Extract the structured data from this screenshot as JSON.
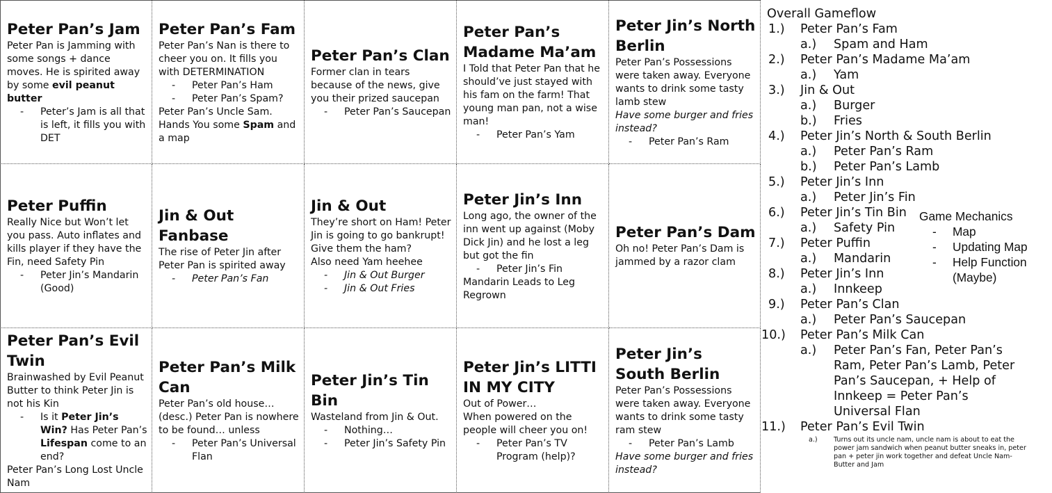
{
  "cells": [
    {
      "title": "Peter Pan’s Jam",
      "lines": [
        {
          "t": "Peter Pan is Jamming with some songs + dance moves. He is spirited away by some "
        },
        {
          "t": "evil peanut butter",
          "b": true
        },
        {
          "t": "Peter’s Jam is all that is left, it fills you with DET",
          "sub": true
        }
      ]
    },
    {
      "title": "Peter Pan’s Fam",
      "lines": [
        {
          "t": "Peter Pan’s Nan is there to cheer you on. It fills you with DETERMINATION"
        },
        {
          "t": "Peter Pan’s Ham",
          "sub": true
        },
        {
          "t": "Peter Pan’s Spam?",
          "sub": true
        },
        {
          "t": "Peter Pan’s Uncle Sam. Hands You some "
        },
        {
          "t": "Spam",
          "b": true
        },
        {
          "t": " and a map"
        }
      ]
    },
    {
      "title": "Peter Pan’s Clan",
      "lines": [
        {
          "t": "Former clan in tears because of the news, give you their prized saucepan"
        },
        {
          "t": "Peter Pan’s Saucepan",
          "sub": true
        }
      ]
    },
    {
      "title": "Peter Pan’s Madame Ma’am",
      "lines": [
        {
          "t": "I Told that Peter Pan that he should’ve just stayed with his fam on the farm! That young man pan, not a wise man!"
        },
        {
          "t": "Peter Pan’s Yam",
          "sub": true
        }
      ]
    },
    {
      "title": "Peter Jin’s North Berlin",
      "lines": [
        {
          "t": "Peter Pan’s Possessions were taken away. Everyone wants to drink some tasty lamb stew"
        },
        {
          "t": "Have some burger and fries instead?",
          "i": true
        },
        {
          "t": "Peter Pan’s Ram",
          "sub": true
        }
      ]
    },
    {
      "title": "Peter Puffin",
      "small": true,
      "lines": [
        {
          "t": "Really Nice but Won’t let you pass. Auto inflates and kills player if they have the Fin, need Safety Pin"
        },
        {
          "t": "Peter Jin’s Mandarin (Good)",
          "sub": true
        }
      ]
    },
    {
      "title": "Jin & Out Fanbase",
      "lines": [
        {
          "t": "The rise of Peter Jin after Peter Pan is spirited away"
        },
        {
          "t": "Peter Pan’s Fan",
          "sub": true,
          "i": true
        }
      ]
    },
    {
      "title": "Jin & Out",
      "lines": [
        {
          "t": "They’re short on Ham! Peter Jin is going to go bankrupt! Give them the ham?"
        },
        {
          "t": "Also need Yam heehee"
        },
        {
          "t": "Jin & Out Burger",
          "sub": true,
          "i": true
        },
        {
          "t": "Jin & Out Fries",
          "sub": true,
          "i": true
        }
      ]
    },
    {
      "title": "Peter Jin’s Inn",
      "lines": [
        {
          "t": "Long ago, the owner of the inn went up against (Moby Dick Jin) and he lost a leg but got the fin"
        },
        {
          "t": "Peter Jin’s Fin",
          "sub": true
        },
        {
          "t": "Mandarin Leads to Leg Regrown"
        }
      ]
    },
    {
      "title": "Peter Pan’s Dam",
      "lines": [
        {
          "t": "Oh no! Peter Pan’s Dam is jammed by a razor clam"
        }
      ]
    },
    {
      "title": "Peter Pan’s Evil Twin",
      "lines": [
        {
          "t": "Brainwashed by Evil Peanut Butter to think Peter Jin is not his Kin"
        },
        {
          "t": "Is it ",
          "sub": true,
          "rich": [
            [
              "Is it ",
              false
            ],
            [
              "Peter Jin’s Win?",
              true
            ],
            [
              " Has Peter Pan’s ",
              false
            ],
            [
              "Lifespan",
              true
            ],
            [
              " come to an end?",
              false
            ]
          ]
        },
        {
          "t": "Peter Pan’s Long Lost Uncle Nam"
        }
      ]
    },
    {
      "title": "Peter Pan’s Milk Can",
      "lines": [
        {
          "t": "Peter Pan’s old house… (desc.) Peter Pan is nowhere to be found… unless"
        },
        {
          "t": "Peter Pan’s Universal Flan",
          "sub": true
        }
      ]
    },
    {
      "title": "Peter Jin’s Tin Bin",
      "lines": [
        {
          "t": "Wasteland from Jin & Out."
        },
        {
          "t": "Nothing…",
          "sub": true
        },
        {
          "t": "Peter Jin’s Safety Pin",
          "sub": true
        }
      ]
    },
    {
      "title": "Peter Jin’s LITTI IN MY CITY",
      "lines": [
        {
          "t": "Out of Power…"
        },
        {
          "t": "When powered on the people will cheer you on!"
        },
        {
          "t": "Peter Pan’s TV Program (help)?",
          "sub": true
        }
      ]
    },
    {
      "title": "Peter Jin’s South Berlin",
      "lines": [
        {
          "t": "Peter Pan’s Possessions were taken away. Everyone wants to drink some tasty ram stew"
        },
        {
          "t": "Peter Pan’s Lamb",
          "sub": true
        },
        {
          "t": "Have some burger and fries instead?",
          "i": true
        }
      ]
    }
  ],
  "overview": {
    "heading": "Overall Gameflow",
    "steps": [
      {
        "num": "1.)",
        "label": "Peter Pan’s Fam",
        "subs": [
          {
            "num": "a.)",
            "label": "Spam and Ham"
          }
        ]
      },
      {
        "num": "2.)",
        "label": "Peter Pan’s Madame Ma’am",
        "subs": [
          {
            "num": "a.)",
            "label": "Yam"
          }
        ]
      },
      {
        "num": "3.)",
        "label": "Jin & Out",
        "subs": [
          {
            "num": "a.)",
            "label": "Burger"
          },
          {
            "num": "b.)",
            "label": "Fries"
          }
        ]
      },
      {
        "num": "4.)",
        "label": "Peter Jin’s North & South Berlin",
        "subs": [
          {
            "num": "a.)",
            "label": "Peter Pan’s Ram"
          },
          {
            "num": "b.)",
            "label": "Peter Pan’s Lamb"
          }
        ]
      },
      {
        "num": "5.)",
        "label": "Peter Jin’s Inn",
        "subs": [
          {
            "num": "a.)",
            "label": "Peter Jin’s Fin"
          }
        ]
      },
      {
        "num": "6.)",
        "label": "Peter Jin’s Tin Bin",
        "subs": [
          {
            "num": "a.)",
            "label": "Safety Pin"
          }
        ]
      },
      {
        "num": "7.)",
        "label": "Peter Puffin",
        "subs": [
          {
            "num": "a.)",
            "label": "Mandarin"
          }
        ]
      },
      {
        "num": "8.)",
        "label": "Peter Jin’s Inn",
        "subs": [
          {
            "num": "a.)",
            "label": "Innkeep"
          }
        ]
      },
      {
        "num": "9.)",
        "label": "Peter Pan’s Clan",
        "subs": [
          {
            "num": "a.)",
            "label": "Peter Pan’s Saucepan"
          }
        ]
      },
      {
        "num": "10.)",
        "label": "Peter Pan’s Milk Can",
        "subs": [
          {
            "num": "a.)",
            "label": "Peter Pan’s Fan, Peter Pan’s Ram, Peter Pan’s Lamb, Peter Pan’s Saucepan, + Help of Innkeep = Peter Pan’s Universal Flan"
          }
        ]
      },
      {
        "num": "11.)",
        "label": "Peter Pan’s Evil Twin",
        "subs": [
          {
            "num": "a.)",
            "label": "Turns out its uncle nam, uncle nam is about to eat the power jam sandwich when peanut butter sneaks in, peter pan + peter jin work together and defeat Uncle Nam-Butter and Jam"
          }
        ]
      }
    ]
  },
  "mechanics": {
    "heading": "Game Mechanics",
    "items": [
      "Map",
      "Updating Map",
      "Help Function (Maybe)"
    ]
  }
}
